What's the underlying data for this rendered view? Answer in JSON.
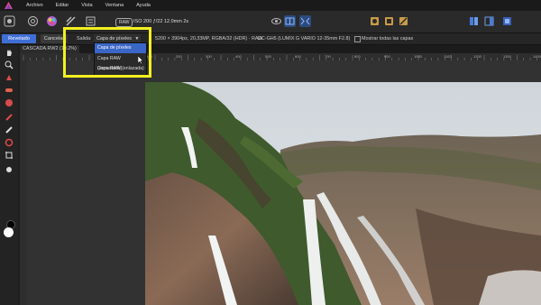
{
  "menubar": {
    "items": [
      "Archivo",
      "Editar",
      "Vista",
      "Ventana",
      "Ayuda"
    ]
  },
  "toolbar": {
    "raw_tag": "RAW",
    "exif": "ISO 200 ƒ/22 12.0mm 2s"
  },
  "context": {
    "develop_label": "Revelado",
    "cancel_label": "Cancelar",
    "output_label": "Salida:",
    "output_selected": "Capa de píxeles",
    "image_info": "5200 × 3904px, 20,33MP, RGBA/32 (HDR) · RAW",
    "camera_info": "DC-GH5 (LUMIX G VARIO 12-35mm F2.8)",
    "show_layers_label": "Mostrar todas las capas"
  },
  "document": {
    "tab_label": "CASCADA.RW2 (19.2%)"
  },
  "ruler": {
    "ticks": [
      "100",
      "200",
      "300",
      "400",
      "500",
      "600",
      "700",
      "800",
      "900",
      "1000",
      "1100",
      "1200",
      "1300",
      "1400",
      "1500"
    ]
  },
  "dropdown": {
    "options": [
      "Capa de píxeles",
      "Capa RAW (incrustada)",
      "Capa RAW (enlazada)"
    ],
    "selected_index": 0
  },
  "colors": {
    "accent": "#3f6fd6",
    "highlight": "#f3f01f",
    "background": "#1e1e1e"
  }
}
